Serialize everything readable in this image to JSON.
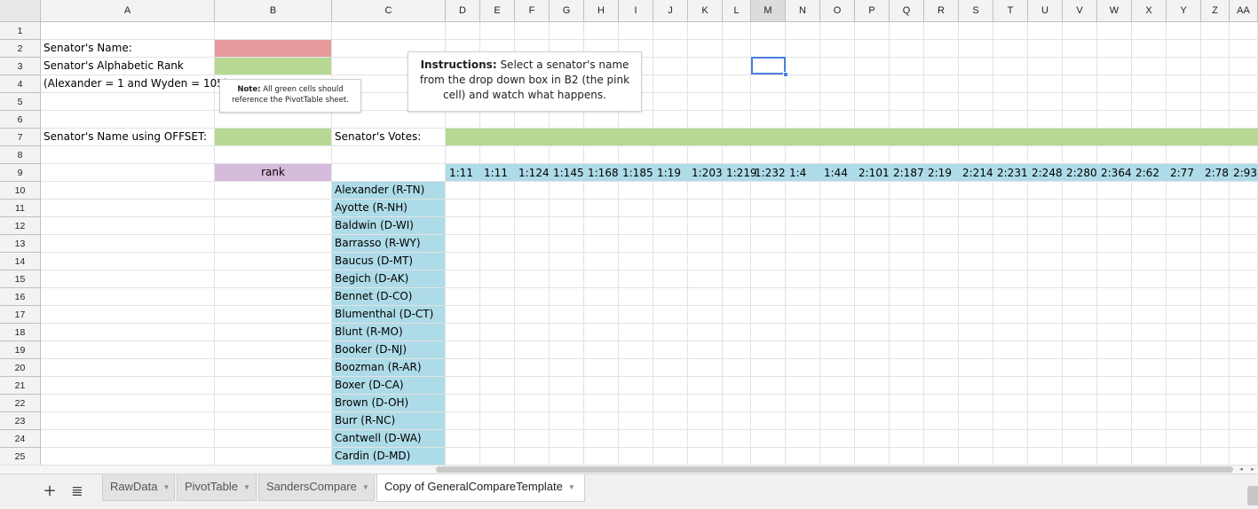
{
  "columns": [
    "A",
    "B",
    "C",
    "D",
    "E",
    "F",
    "G",
    "H",
    "I",
    "J",
    "K",
    "L",
    "M",
    "N",
    "O",
    "P",
    "Q",
    "R",
    "S",
    "T",
    "U",
    "V",
    "W",
    "X",
    "Y",
    "Z",
    "AA"
  ],
  "selected_column": "M",
  "rows": [
    "1",
    "2",
    "3",
    "4",
    "5",
    "6",
    "7",
    "8",
    "9",
    "10",
    "11",
    "12",
    "13",
    "14",
    "15",
    "16",
    "17",
    "18",
    "19",
    "20",
    "21",
    "22",
    "23",
    "24",
    "25"
  ],
  "labels": {
    "a2": "Senator's Name:",
    "a3": "Senator's Alphabetic Rank",
    "a4": "(Alexander = 1 and Wyden = 105)",
    "a7": "Senator's Name using OFFSET:",
    "c7": "Senator's Votes:",
    "b9": "rank"
  },
  "note": {
    "bold": "Note:",
    "text": " All green cells should reference the PivotTable sheet."
  },
  "instructions": {
    "bold": "Instructions:",
    "text": " Select a senator's name from the drop down box in B2 (the pink cell) and watch what happens."
  },
  "votes": [
    "1:11",
    "1:11",
    "1:124",
    "1:145",
    "1:168",
    "1:185",
    "1:19",
    "1:203",
    "1:219",
    "1:232",
    "1:4",
    "1:44",
    "2:101",
    "2:187",
    "2:19",
    "2:214",
    "2:231",
    "2:248",
    "2:280",
    "2:364",
    "2:62",
    "2:77",
    "2:78",
    "2:93"
  ],
  "senators": [
    "Alexander (R-TN)",
    "Ayotte (R-NH)",
    "Baldwin (D-WI)",
    "Barrasso (R-WY)",
    "Baucus (D-MT)",
    "Begich (D-AK)",
    "Bennet (D-CO)",
    "Blumenthal (D-CT)",
    "Blunt (R-MO)",
    "Booker (D-NJ)",
    "Boozman (R-AR)",
    "Boxer (D-CA)",
    "Brown (D-OH)",
    "Burr (R-NC)",
    "Cantwell (D-WA)",
    "Cardin (D-MD)"
  ],
  "tabs": [
    {
      "label": "RawData",
      "active": false
    },
    {
      "label": "PivotTable",
      "active": false
    },
    {
      "label": "SandersCompare",
      "active": false
    },
    {
      "label": "Copy of GeneralCompareTemplate",
      "active": true
    }
  ],
  "toolbar": {
    "add_sheet": "+",
    "all_sheets": "≣"
  },
  "colors": {
    "pink": "#e6999b",
    "green": "#b7d993",
    "purple": "#d5bbdc",
    "blue": "#aedbe8",
    "selection": "#4a7fdd"
  }
}
